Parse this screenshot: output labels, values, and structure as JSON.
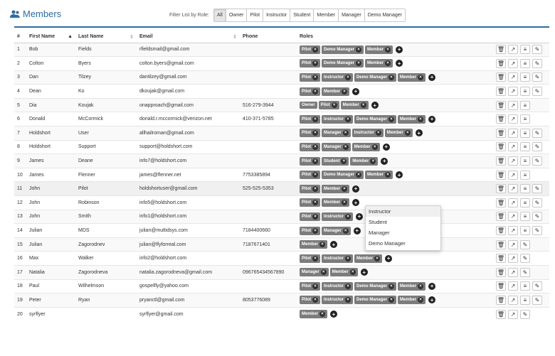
{
  "header": {
    "title": "Members",
    "filter_label": "Filter List by Role:",
    "filter_options": [
      "All",
      "Owner",
      "Pilot",
      "Instructor",
      "Student",
      "Member",
      "Manager",
      "Demo Manager"
    ],
    "filter_active": "All"
  },
  "columns": [
    "#",
    "First Name",
    "Last Name",
    "Email",
    "Phone",
    "Roles",
    ""
  ],
  "rows": [
    {
      "n": "1",
      "first": "Bob",
      "last": "Fields",
      "email": "rfieldsmail@gmail.com",
      "phone": "",
      "roles": [
        "Pilot",
        "Demo Manager",
        "Member"
      ],
      "edit": true
    },
    {
      "n": "2",
      "first": "Colton",
      "last": "Byers",
      "email": "colton.byers@gmail.com",
      "phone": "",
      "roles": [
        "Pilot",
        "Demo Manager",
        "Member"
      ],
      "edit": true
    },
    {
      "n": "3",
      "first": "Dan",
      "last": "Tilzey",
      "email": "dantilzey@gmail.com",
      "phone": "",
      "roles": [
        "Pilot",
        "Instructor",
        "Demo Manager",
        "Member"
      ],
      "edit": true
    },
    {
      "n": "4",
      "first": "Dean",
      "last": "Ko",
      "email": "dkoujak@gmail.com",
      "phone": "",
      "roles": [
        "Pilot",
        "Member"
      ],
      "edit": true
    },
    {
      "n": "5",
      "first": "Dia",
      "last": "Koujak",
      "email": "onapproach@gmail.com",
      "phone": "516-279-3944",
      "roles": [
        "Owner",
        "Pilot",
        "Member"
      ],
      "edit": false,
      "owner": true
    },
    {
      "n": "6",
      "first": "Donald",
      "last": "McCormick",
      "email": "donald.r.mccormick@verizon.net",
      "phone": "410-371-5785",
      "roles": [
        "Pilot",
        "Instructor",
        "Demo Manager",
        "Member"
      ],
      "edit": false
    },
    {
      "n": "7",
      "first": "Holdshort",
      "last": "User",
      "email": "allhailroman@gmail.com",
      "phone": "",
      "roles": [
        "Pilot",
        "Manager",
        "Instructor",
        "Member"
      ],
      "edit": true
    },
    {
      "n": "8",
      "first": "Holdshort",
      "last": "Support",
      "email": "support@holdshort.com",
      "phone": "",
      "roles": [
        "Pilot",
        "Manager",
        "Member"
      ],
      "edit": true
    },
    {
      "n": "9",
      "first": "James",
      "last": "Deane",
      "email": "info7@holdshort.com",
      "phone": "",
      "roles": [
        "Pilot",
        "Student",
        "Member"
      ],
      "edit": true
    },
    {
      "n": "10",
      "first": "James",
      "last": "Flenner",
      "email": "james@flenner.net",
      "phone": "7753385894",
      "roles": [
        "Pilot",
        "Demo Manager",
        "Member"
      ],
      "edit": false
    },
    {
      "n": "11",
      "first": "John",
      "last": "Pilot",
      "email": "holdshortuser@gmail.com",
      "phone": "525-525-5353",
      "roles": [
        "Pilot",
        "Member"
      ],
      "edit": true,
      "highlight": true
    },
    {
      "n": "12",
      "first": "John",
      "last": "Robinson",
      "email": "info5@holdshort.com",
      "phone": "",
      "roles": [
        "Pilot",
        "Member"
      ],
      "edit": true
    },
    {
      "n": "13",
      "first": "John",
      "last": "Smith",
      "email": "info1@holdshort.com",
      "phone": "",
      "roles": [
        "Pilot",
        "Instructor"
      ],
      "edit": true
    },
    {
      "n": "14",
      "first": "Julian",
      "last": "MDS",
      "email": "julian@multidsys.com",
      "phone": "7184400660",
      "roles": [
        "Pilot",
        "Manager"
      ],
      "edit": true
    },
    {
      "n": "15",
      "first": "Julian",
      "last": "Zagorodnev",
      "email": "julian@flyforreal.com",
      "phone": "7187671401",
      "roles": [
        "Member"
      ],
      "edit": true,
      "no_menu": true
    },
    {
      "n": "16",
      "first": "Max",
      "last": "Walker",
      "email": "info2@holdshort.com",
      "phone": "",
      "roles": [
        "Pilot",
        "Instructor",
        "Member"
      ],
      "edit": true,
      "no_menu": true
    },
    {
      "n": "17",
      "first": "Natalia",
      "last": "Zagorodneva",
      "email": "natalia.zagorodneva@gmail.com",
      "phone": "096765434567890",
      "roles": [
        "Manager",
        "Member"
      ],
      "edit": true,
      "no_menu": true
    },
    {
      "n": "18",
      "first": "Paul",
      "last": "Wilhelmson",
      "email": "gospelfly@yahoo.com",
      "phone": "",
      "roles": [
        "Pilot",
        "Instructor",
        "Demo Manager",
        "Member"
      ],
      "edit": true
    },
    {
      "n": "19",
      "first": "Peter",
      "last": "Ryan",
      "email": "pryanctl@gmail.com",
      "phone": "8053776089",
      "roles": [
        "Pilot",
        "Instructor",
        "Demo Manager",
        "Member"
      ],
      "edit": true
    },
    {
      "n": "20",
      "first": "syrflyer",
      "last": "",
      "email": "syrflyer@gmail.com",
      "phone": "",
      "roles": [
        "Member"
      ],
      "edit": true,
      "no_menu": true
    }
  ],
  "dropdown": {
    "items": [
      "Instructor",
      "Student",
      "Manager",
      "Demo Manager"
    ],
    "hovered": "Instructor"
  },
  "icons": {
    "remove": "×",
    "add": "+",
    "delete": "trash-icon",
    "open": "external-link-icon",
    "menu": "list-icon",
    "edit": "pencil-icon"
  },
  "colors": {
    "accent": "#2d6ca2",
    "badge": "#7c7c7c"
  }
}
